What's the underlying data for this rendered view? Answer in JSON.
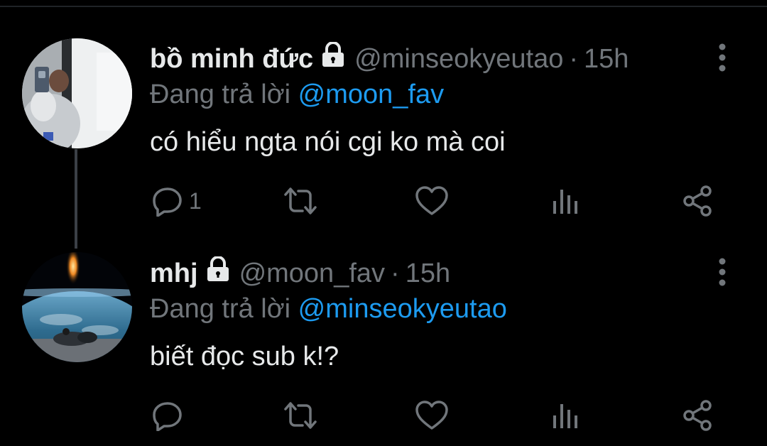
{
  "tweets": [
    {
      "display_name": "bồ minh đức",
      "handle": "@minseokyeutao",
      "separator": "·",
      "time": "15h",
      "reply_prefix": "Đang trả lời",
      "reply_to": "@moon_fav",
      "text": "có hiểu ngta nói cgi ko mà coi",
      "reply_count": "1"
    },
    {
      "display_name": "mhj",
      "handle": "@moon_fav",
      "separator": "·",
      "time": "15h",
      "reply_prefix": "Đang trả lời",
      "reply_to": "@minseokyeutao",
      "text": "biết đọc sub k!?",
      "reply_count": ""
    }
  ],
  "icons": {
    "reply": "reply-icon",
    "retweet": "retweet-icon",
    "like": "like-icon",
    "views": "views-icon",
    "share": "share-icon",
    "more": "more-icon",
    "lock": "lock-icon"
  },
  "colors": {
    "background": "#000000",
    "text": "#e7e9ea",
    "muted": "#71767b",
    "accent": "#1d9bf0"
  }
}
